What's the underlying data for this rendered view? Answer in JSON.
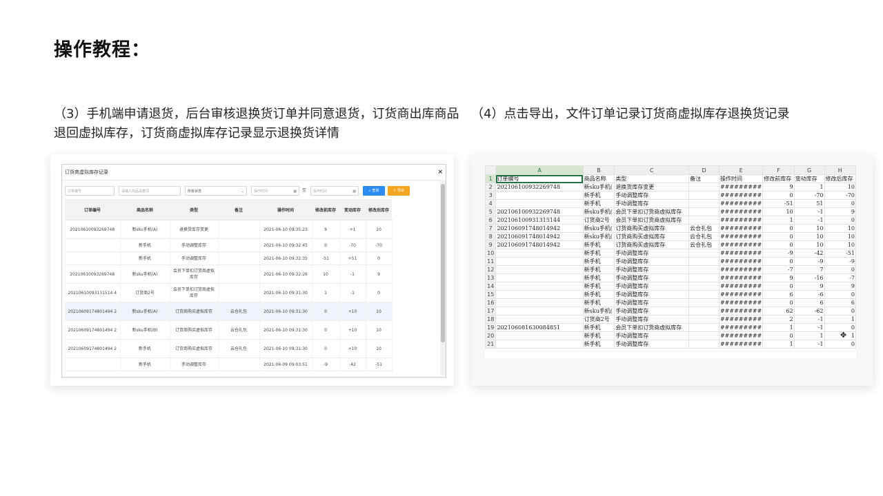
{
  "title": "操作教程：",
  "step3": {
    "text": "（3）手机端申请退货，后台审核退换货订单并同意退货，订货商出库商品退回虚拟库存，订货商虚拟库存记录显示退换货详情",
    "modal": {
      "title": "订货商虚拟库存记录",
      "close": "×",
      "filters": {
        "order_placeholder": "订单编号",
        "product_placeholder": "请输入商品关键词",
        "status_value": "所有状态",
        "start_placeholder": "操作时间",
        "to": "至",
        "end_placeholder": "操作时间",
        "query": "查询",
        "export": "导出"
      },
      "columns": [
        "订单编号",
        "商品名称",
        "类型",
        "备注",
        "操作时间",
        "修改前库存",
        "变动库存",
        "修改后库存"
      ],
      "rows": [
        [
          "20210610093269748",
          "新sku手机(A)",
          "退换货库存变更",
          "",
          "2021-06-10 09:35:23",
          "9",
          "+1",
          "10"
        ],
        [
          "",
          "新手机",
          "手动调整库存",
          "",
          "2021-06-10 09:32:45",
          "0",
          "-70",
          "-70"
        ],
        [
          "",
          "新手机",
          "手动调整库存",
          "",
          "2021-06-10 09:32:35",
          "-51",
          "+51",
          "0"
        ],
        [
          "20210610093269748",
          "新sku手机(A)",
          "会员下单扣订货商虚拟库存",
          "",
          "2021-06-10 09:32:26",
          "10",
          "-1",
          "9"
        ],
        [
          "20210610093131514 4",
          "订货商2号",
          "会员下单扣订货商虚拟库存",
          "",
          "2021-06-10 09:31:30",
          "1",
          "-1",
          "0"
        ],
        [
          "20210609174801494 2",
          "新sku手机(A)",
          "订货商购买虚拟库存",
          "云仓礼包",
          "2021-06-10 09:31:30",
          "0",
          "+10",
          "10"
        ],
        [
          "20210609174801494 2",
          "新sku手机(B)",
          "订货商购买虚拟库存",
          "云仓礼包",
          "2021-06-10 09:31:30",
          "0",
          "+10",
          "10"
        ],
        [
          "20210609174801494 2",
          "新手机",
          "订货商购买虚拟库存",
          "云仓礼包",
          "2021-06-10 09:31:30",
          "0",
          "+10",
          "10"
        ],
        [
          "",
          "新手机",
          "手动调整库存",
          "",
          "2021-06-09 09:03:51",
          "-9",
          "-42",
          "-51"
        ]
      ]
    }
  },
  "step4": {
    "text": "（4）点击导出，文件订单记录订货商虚拟库存退换货记录",
    "sheet": {
      "col_letters": [
        "",
        "A",
        "B",
        "C",
        "D",
        "E",
        "F",
        "G",
        "H"
      ],
      "rows": [
        [
          "1",
          "订单编号",
          "商品名称",
          "类型",
          "备注",
          "操作时间",
          "修改前库存",
          "变动库存",
          "修改后库存"
        ],
        [
          "2",
          "202106100932269748",
          "新sku手机(",
          "退换货库存变更",
          "",
          "#########",
          "9",
          "1",
          "10"
        ],
        [
          "3",
          "",
          "新手机",
          "手动调整库存",
          "",
          "#########",
          "0",
          "-70",
          "-70"
        ],
        [
          "4",
          "",
          "新手机",
          "手动调整库存",
          "",
          "#########",
          "-51",
          "51",
          "0"
        ],
        [
          "5",
          "202106100932269748",
          "新sku手机(",
          "会员下单扣订货商虚拟库存",
          "",
          "#########",
          "10",
          "-1",
          "9"
        ],
        [
          "6",
          "202106100931315144",
          "订货商2号",
          "会员下单扣订货商虚拟库存",
          "",
          "#########",
          "1",
          "-1",
          "0"
        ],
        [
          "7",
          "202106091748014942",
          "新sku手机(",
          "订货商购买虚拟库存",
          "云仓礼包",
          "#########",
          "0",
          "10",
          "10"
        ],
        [
          "8",
          "202106091748014942",
          "新sku手机(",
          "订货商购买虚拟库存",
          "云仓礼包",
          "#########",
          "0",
          "10",
          "10"
        ],
        [
          "9",
          "202106091748014942",
          "新手机",
          "订货商购买虚拟库存",
          "云仓礼包",
          "#########",
          "0",
          "10",
          "10"
        ],
        [
          "10",
          "",
          "新手机",
          "手动调整库存",
          "",
          "#########",
          "-9",
          "-42",
          "-51"
        ],
        [
          "11",
          "",
          "新手机",
          "手动调整库存",
          "",
          "#########",
          "0",
          "-9",
          "-9"
        ],
        [
          "12",
          "",
          "新手机",
          "手动调整库存",
          "",
          "#########",
          "-7",
          "7",
          "0"
        ],
        [
          "13",
          "",
          "新手机",
          "手动调整库存",
          "",
          "#########",
          "9",
          "-16",
          "-7"
        ],
        [
          "14",
          "",
          "新手机",
          "手动调整库存",
          "",
          "#########",
          "0",
          "9",
          "9"
        ],
        [
          "15",
          "",
          "新手机",
          "手动调整库存",
          "",
          "#########",
          "6",
          "-6",
          "0"
        ],
        [
          "16",
          "",
          "新手机",
          "手动调整库存",
          "",
          "#########",
          "0",
          "6",
          "6"
        ],
        [
          "17",
          "",
          "新sku手机(",
          "手动调整库存",
          "",
          "#########",
          "62",
          "-62",
          "0"
        ],
        [
          "18",
          "",
          "订货商2号",
          "手动调整库存",
          "",
          "#########",
          "2",
          "-1",
          "1"
        ],
        [
          "19",
          "202106081630084851",
          "新手机",
          "会员下单扣订货商虚拟库存",
          "",
          "#########",
          "1",
          "-1",
          "0"
        ],
        [
          "20",
          "",
          "新手机",
          "手动调整库存",
          "",
          "#########",
          "0",
          "1",
          "1"
        ],
        [
          "21",
          "",
          "新手机",
          "手动调整库存",
          "",
          "#########",
          "1",
          "-1",
          "0"
        ]
      ]
    }
  },
  "colors": {
    "query_btn": "#2d8cf0",
    "export_btn": "#f5a623",
    "excel_green": "#217346"
  }
}
